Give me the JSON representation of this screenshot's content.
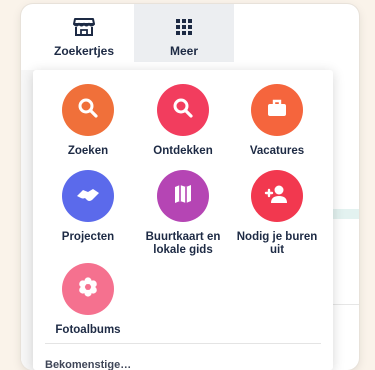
{
  "tabs": {
    "zoekertjes": {
      "label": "Zoekertjes",
      "icon": "storefront-icon"
    },
    "meer": {
      "label": "Meer",
      "icon": "grid-icon"
    }
  },
  "menu": {
    "items": [
      {
        "label": "Zoeken",
        "icon": "search-icon",
        "color": "#f0703a"
      },
      {
        "label": "Ontdekken",
        "icon": "search-icon",
        "color": "#f23d5e"
      },
      {
        "label": "Vacatures",
        "icon": "briefcase-icon",
        "color": "#f5653d"
      },
      {
        "label": "Projecten",
        "icon": "handshake-icon",
        "color": "#5b6aeb"
      },
      {
        "label": "Buurtkaart en lokale gids",
        "icon": "map-icon",
        "color": "#b545b4"
      },
      {
        "label": "Nodig je buren uit",
        "icon": "add-user-icon",
        "color": "#f2384f"
      },
      {
        "label": "Fotoalbums",
        "icon": "flower-icon",
        "color": "#f5718f"
      }
    ],
    "cutoff_label": "Bekomenstige…"
  },
  "colors": {
    "text": "#1d2a44",
    "active_tab_bg": "#eceef1"
  }
}
